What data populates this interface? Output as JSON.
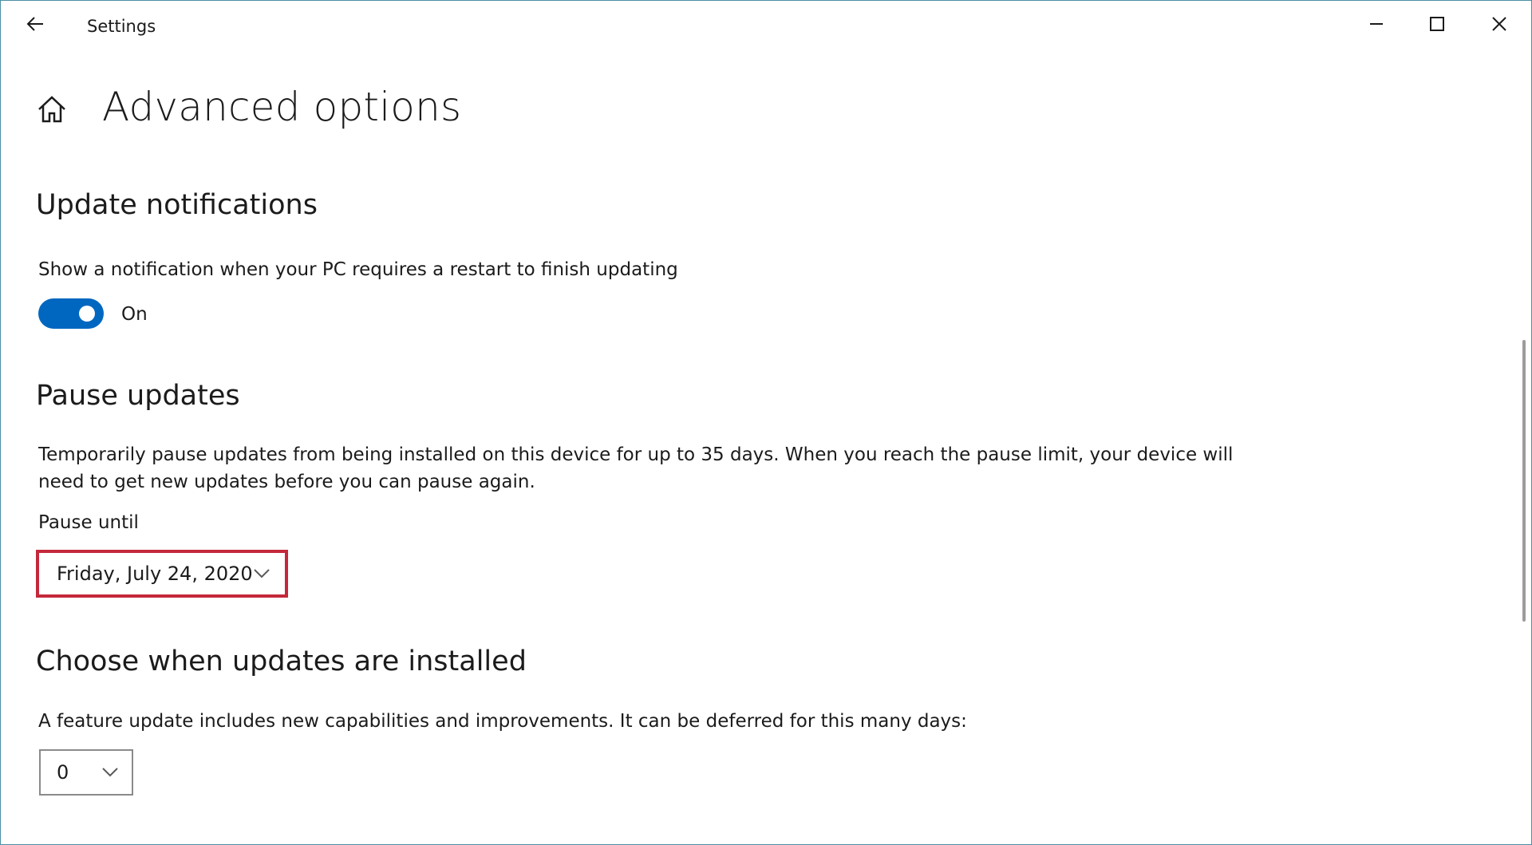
{
  "window": {
    "title": "Settings",
    "controls": {
      "back_icon": "arrow-left-icon",
      "minimize_icon": "minimize-icon",
      "maximize_icon": "maximize-icon",
      "close_icon": "close-icon"
    }
  },
  "header": {
    "home_icon": "home-icon",
    "title": "Advanced options"
  },
  "update_notifications": {
    "heading": "Update notifications",
    "description": "Show a notification when your PC requires a restart to finish updating",
    "toggle": {
      "state": "On",
      "checked": true
    }
  },
  "pause_updates": {
    "heading": "Pause updates",
    "description_line1": "Temporarily pause updates from being installed on this device for up to 35 days. When you reach the pause limit, your device will",
    "description_line2": "need to get new updates before you can pause again.",
    "pause_until_label": "Pause until",
    "pause_until_value": "Friday, July 24, 2020"
  },
  "choose_when": {
    "heading": "Choose when updates are installed",
    "feature_update_text": "A feature update includes new capabilities and improvements. It can be deferred for this many days:",
    "feature_defer_value": "0"
  },
  "colors": {
    "accent": "#0067c0",
    "highlight_border": "#c4283a"
  }
}
